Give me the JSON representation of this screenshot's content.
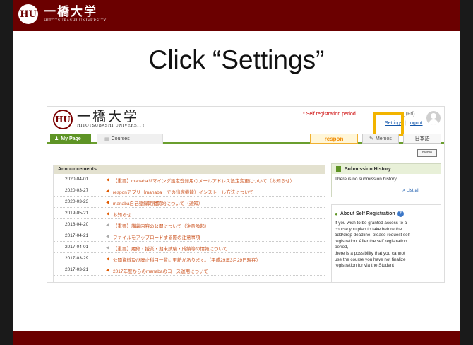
{
  "slide": {
    "logo_main": "一橋大学",
    "logo_sub": "HITOTSUBASHI UNIVERSITY",
    "emblem": "HU",
    "title": "Click “Settings”"
  },
  "header": {
    "logo_main": "一橋大学",
    "logo_sub": "HITOTSUBASHI UNIVERSITY",
    "emblem": "HU",
    "self_reg_notice": "* Self registration period",
    "date": "2020-04-0_ (Fri)",
    "settings_label": "Settings",
    "separator": "|",
    "logout_label": "ogout"
  },
  "nav": {
    "mypage_label": "My Page",
    "courses_label": "Courses",
    "respon_label": "respon",
    "memos_label": "Memos",
    "language_label": "日本語"
  },
  "memo_icon_label": "memo",
  "announcements": {
    "heading": "Announcements",
    "items": [
      {
        "date": "2020-04-01",
        "title": "【重要】manabaリマインダ設定登録用のメールアドレス設定変更について（お知らせ）"
      },
      {
        "date": "2020-03-27",
        "title": "responアプリ（manaba上での出席機能）インストール方法について"
      },
      {
        "date": "2020-03-23",
        "title": "manaba自己登録期間開始について（通知）"
      },
      {
        "date": "2019-05-21",
        "title": "お知らせ"
      },
      {
        "date": "2018-04-20",
        "title": "【重要】講義内容の公開について（注意喚起）"
      },
      {
        "date": "2017-04-21",
        "title": "ファイルをアップロードする際の注意事項"
      },
      {
        "date": "2017-04-01",
        "title": "【重要】履修・授業・期末試験・成績等の情報について"
      },
      {
        "date": "2017-03-29",
        "title": "公開資料及び廃止科目一覧に更新があります。（平成29年3月29日現在）"
      },
      {
        "date": "2017-03-21",
        "title": "2017年度からのmanabaのコース運用について"
      }
    ]
  },
  "submission": {
    "heading": "Submission History",
    "empty_text": "There is no submission history.",
    "list_all": "> List all"
  },
  "about": {
    "heading": "About Self Registration",
    "lines": [
      "If you wish to be granted access to a",
      "course you plan to take before the",
      "add/drop deadline, please request self",
      "registration. After the self registration",
      "period,",
      "there is a possibility that you cannot",
      "use the course you have not finalize",
      "registration for via the Student"
    ]
  }
}
